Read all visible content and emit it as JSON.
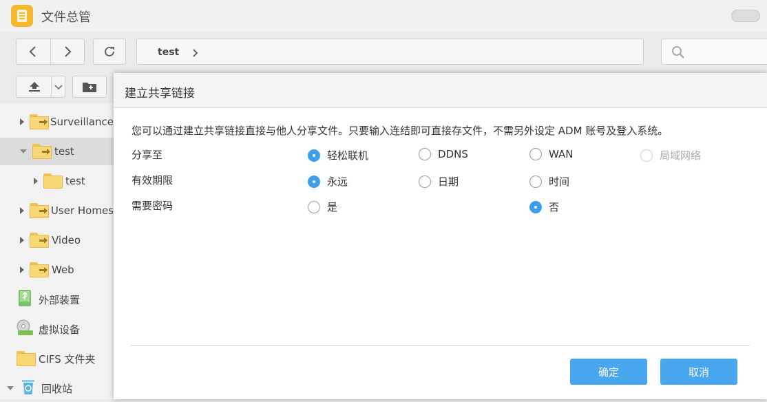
{
  "app": {
    "title": "文件总管"
  },
  "toolbar": {
    "breadcrumb": "test"
  },
  "sidebar": {
    "items": [
      {
        "label": "Surveillance"
      },
      {
        "label": "test"
      },
      {
        "label": "test"
      },
      {
        "label": "User Homes"
      },
      {
        "label": "Video"
      },
      {
        "label": "Web"
      },
      {
        "label": "外部装置"
      },
      {
        "label": "虚拟设备"
      },
      {
        "label": "CIFS 文件夹"
      },
      {
        "label": "回收站"
      }
    ]
  },
  "dialog": {
    "title": "建立共享链接",
    "description": "您可以通过建立共享链接直接与他人分享文件。只要输入连结即可直接存文件，不需另外设定 ADM 账号及登入系统。",
    "share_to": {
      "label": "分享至",
      "options": [
        "轻松联机",
        "DDNS",
        "WAN",
        "局域网络"
      ],
      "selected": "轻松联机"
    },
    "expiry": {
      "label": "有效期限",
      "options": [
        "永远",
        "日期",
        "时间"
      ],
      "selected": "永远"
    },
    "password": {
      "label": "需要密码",
      "options": [
        "是",
        "否"
      ],
      "selected": "否"
    },
    "ok_label": "确定",
    "cancel_label": "取消"
  },
  "colors": {
    "accent": "#3d9eeb",
    "button": "#48a7ee",
    "folder": "#f8d777"
  }
}
